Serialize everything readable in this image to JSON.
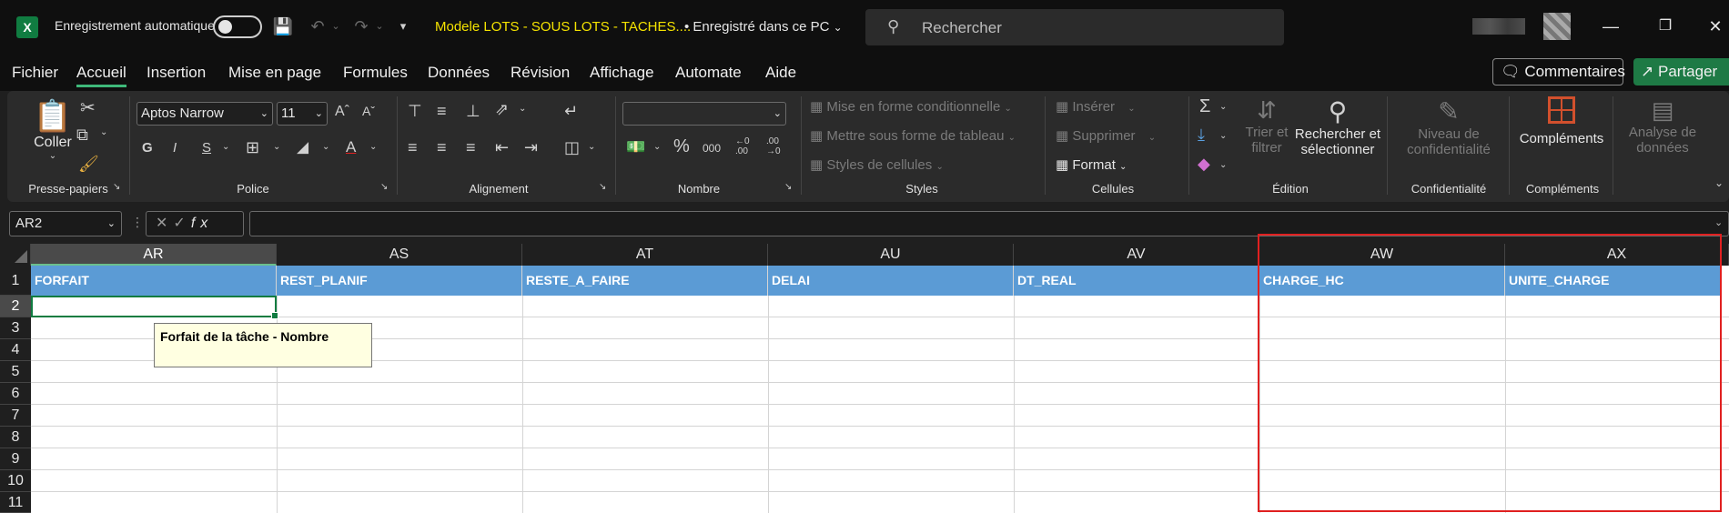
{
  "app": {
    "logo_letter": "X",
    "autosave_label": "Enregistrement automatique",
    "autosave_on": false,
    "doc_title": "Modele LOTS - SOUS LOTS - TACHES....",
    "doc_saved": "• Enregistré dans ce PC",
    "search_placeholder": "Rechercher"
  },
  "menu": {
    "tabs": [
      "Fichier",
      "Accueil",
      "Insertion",
      "Mise en page",
      "Formules",
      "Données",
      "Révision",
      "Affichage",
      "Automate",
      "Aide"
    ],
    "active_tab": "Accueil",
    "comments_label": "Commentaires",
    "share_label": "Partager"
  },
  "ribbon": {
    "groups": {
      "clipboard": "Presse-papiers",
      "font": "Police",
      "alignment": "Alignement",
      "number": "Nombre",
      "styles": "Styles",
      "cells": "Cellules",
      "editing": "Édition",
      "sensitivity": "Confidentialité",
      "addins": "Compléments"
    },
    "paste_label": "Coller",
    "font_name": "Aptos Narrow",
    "font_size": "11",
    "bold": "G",
    "italic": "I",
    "underline": "S",
    "conditional_format": "Mise en forme conditionnelle",
    "format_as_table": "Mettre sous forme de tableau",
    "cell_styles": "Styles de cellules",
    "insert": "Insérer",
    "delete": "Supprimer",
    "format": "Format",
    "sort_filter_1": "Trier et",
    "sort_filter_2": "filtrer",
    "find_select_1": "Rechercher et",
    "find_select_2": "sélectionner",
    "sensitivity_1": "Niveau de",
    "sensitivity_2": "confidentialité",
    "addins_label": "Compléments",
    "analyze_1": "Analyse de",
    "analyze_2": "données",
    "percent": "%",
    "thousands": "000",
    "dec_inc": "←0 .00",
    "dec_dec": ".00 →0"
  },
  "formula_bar": {
    "name_box": "AR2",
    "formula": ""
  },
  "sheet": {
    "columns": [
      "AR",
      "AS",
      "AT",
      "AU",
      "AV",
      "AW",
      "AX"
    ],
    "selected_column": "AR",
    "rows": [
      "1",
      "2",
      "3",
      "4",
      "5",
      "6",
      "7",
      "8",
      "9",
      "10",
      "11"
    ],
    "selected_row": "2",
    "headers": [
      "FORFAIT",
      "REST_PLANIF",
      "RESTE_A_FAIRE",
      "DELAI",
      "DT_REAL",
      "CHARGE_HC",
      "UNITE_CHARGE"
    ],
    "header_fill": "#5b9bd5",
    "tooltip": "Forfait de la tâche - Nombre",
    "highlight_color": "#e02020",
    "highlighted_columns": [
      "AW",
      "AX"
    ]
  }
}
